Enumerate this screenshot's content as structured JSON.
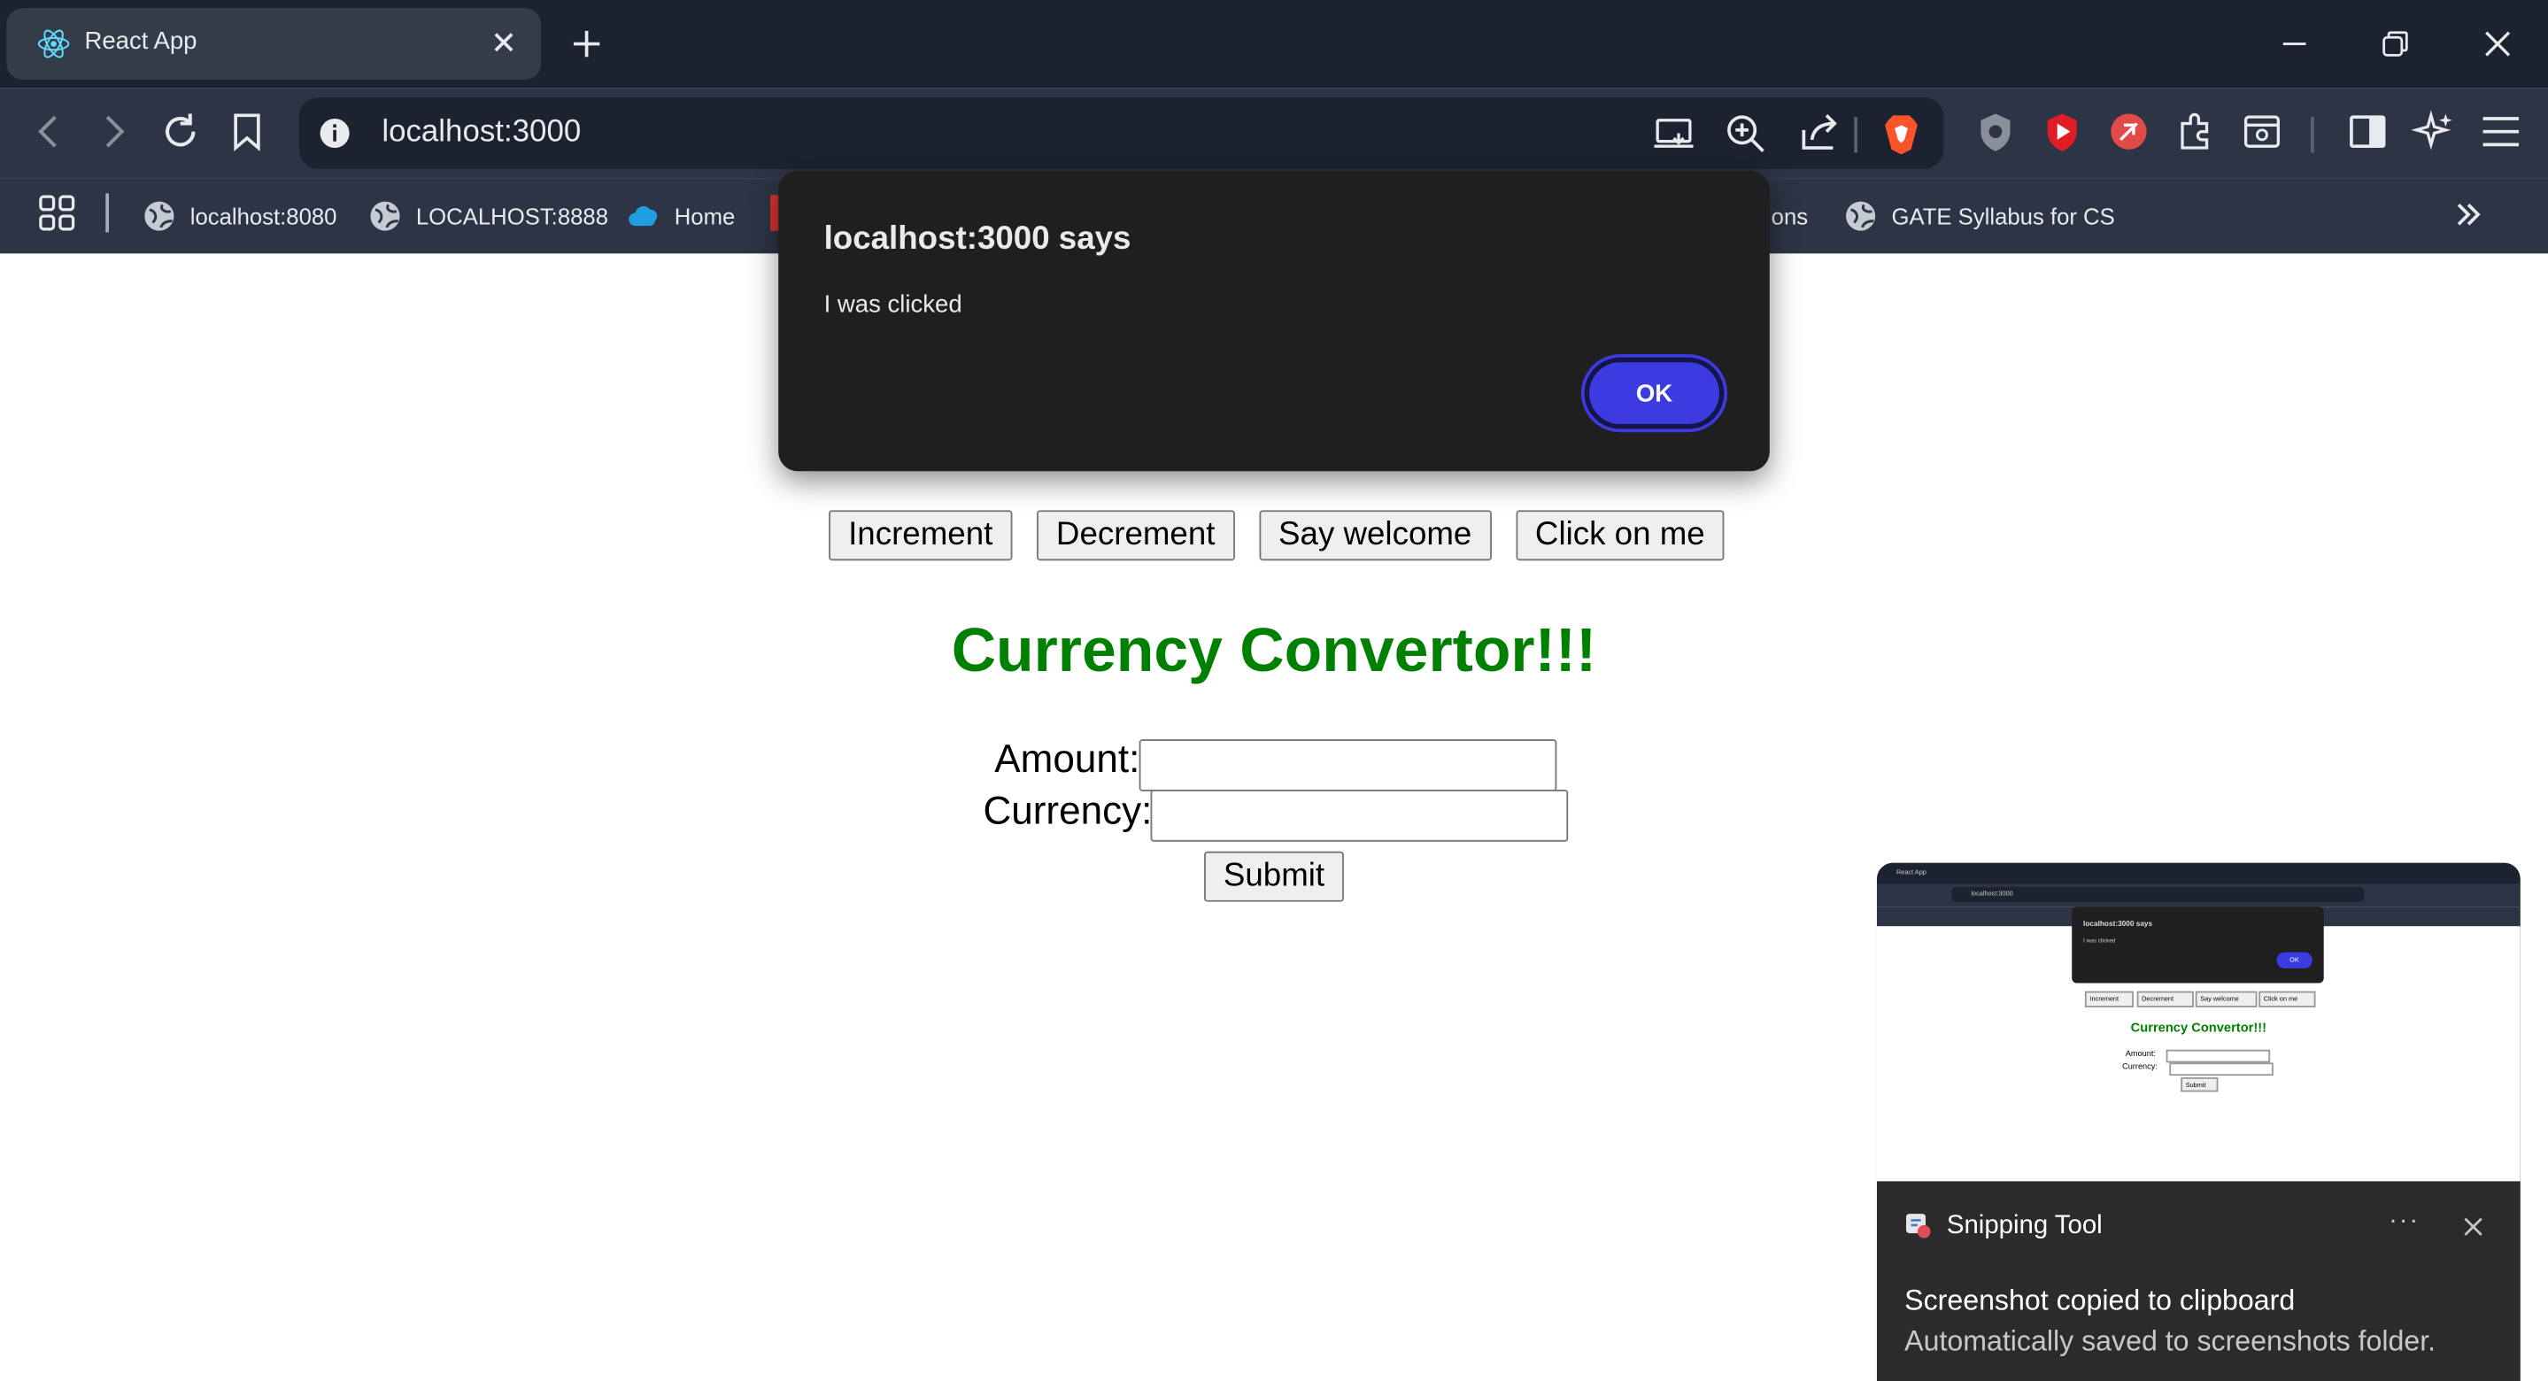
{
  "browser": {
    "tab": {
      "title": "React App",
      "favicon": "react-icon"
    },
    "url": "localhost:3000",
    "bookmarks": [
      {
        "label": "localhost:8080",
        "icon": "globe-icon"
      },
      {
        "label": "LOCALHOST:8888",
        "icon": "globe-icon"
      },
      {
        "label": "Home",
        "icon": "cloud-icon"
      },
      {
        "label": "ons",
        "icon": ""
      },
      {
        "label": "GATE Syllabus for CS",
        "icon": "globe-icon"
      }
    ]
  },
  "dialog": {
    "title": "localhost:3000 says",
    "message": "I was clicked",
    "ok_label": "OK"
  },
  "page": {
    "buttons": [
      "Increment",
      "Decrement",
      "Say welcome",
      "Click on me"
    ],
    "heading": "Currency Convertor!!!",
    "amount_label": "Amount:",
    "currency_label": "Currency:",
    "amount_value": "",
    "currency_value": "",
    "submit_label": "Submit"
  },
  "toast": {
    "app_name": "Snipping Tool",
    "more": "···",
    "title": "Screenshot copied to clipboard",
    "body": "Automatically saved to screenshots folder.",
    "thumb": {
      "tab_title": "React App",
      "url": "localhost:3000",
      "dialog_title": "localhost:3000 says",
      "dialog_message": "I was clicked",
      "ok": "OK",
      "buttons": [
        "Increment",
        "Decrement",
        "Say welcome",
        "Click on me"
      ],
      "heading": "Currency Convertor!!!",
      "amount": "Amount:",
      "currency": "Currency:",
      "submit": "Submit"
    }
  },
  "colors": {
    "heading": "#008000",
    "ok_button": "#3b3be0",
    "tabbar": "#1c2230",
    "toolbar": "#2d3445"
  }
}
